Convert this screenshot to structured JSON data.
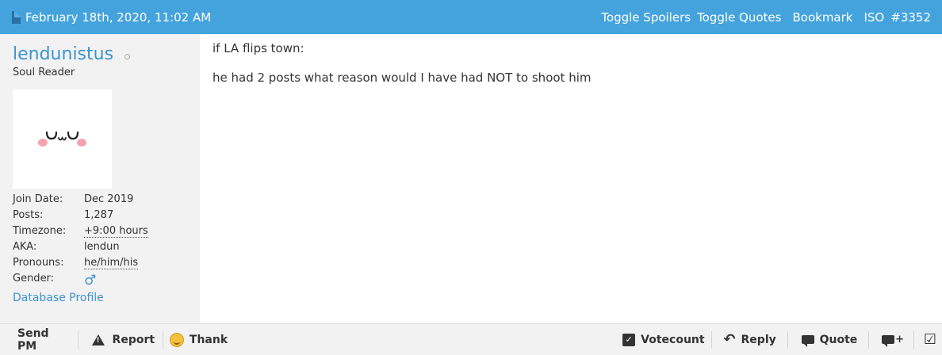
{
  "header": {
    "date": "February 18th, 2020, 11:02 AM",
    "toggle_spoilers": "Toggle Spoilers",
    "toggle_quotes": "Toggle Quotes",
    "bookmark": "Bookmark",
    "iso": "ISO",
    "post_number": "#3352"
  },
  "user": {
    "name": "lendunistus",
    "title": "Soul Reader",
    "avatar_text": "◡ᴗ◡",
    "fields": [
      {
        "label": "Join Date:",
        "value": "Dec 2019"
      },
      {
        "label": "Posts:",
        "value": "1,287"
      },
      {
        "label": "Timezone:",
        "value": "+9:00 hours"
      },
      {
        "label": "AKA:",
        "value": "lendun"
      },
      {
        "label": "Pronouns:",
        "value": "he/him/his"
      },
      {
        "label": "Gender:",
        "value": "♂"
      }
    ],
    "database_profile": "Database Profile"
  },
  "post": {
    "line1": "if LA flips town:",
    "line2": "he had 2 posts what reason would I have had NOT to shoot him"
  },
  "footer": {
    "send_pm": "Send PM",
    "report": "Report",
    "thank": "Thank",
    "votecount": "Votecount",
    "reply": "Reply",
    "quote": "Quote"
  },
  "colors": {
    "header_bg": "#44a3dd",
    "link": "#3d94cf",
    "sidebar_bg": "#f2f2f2"
  }
}
